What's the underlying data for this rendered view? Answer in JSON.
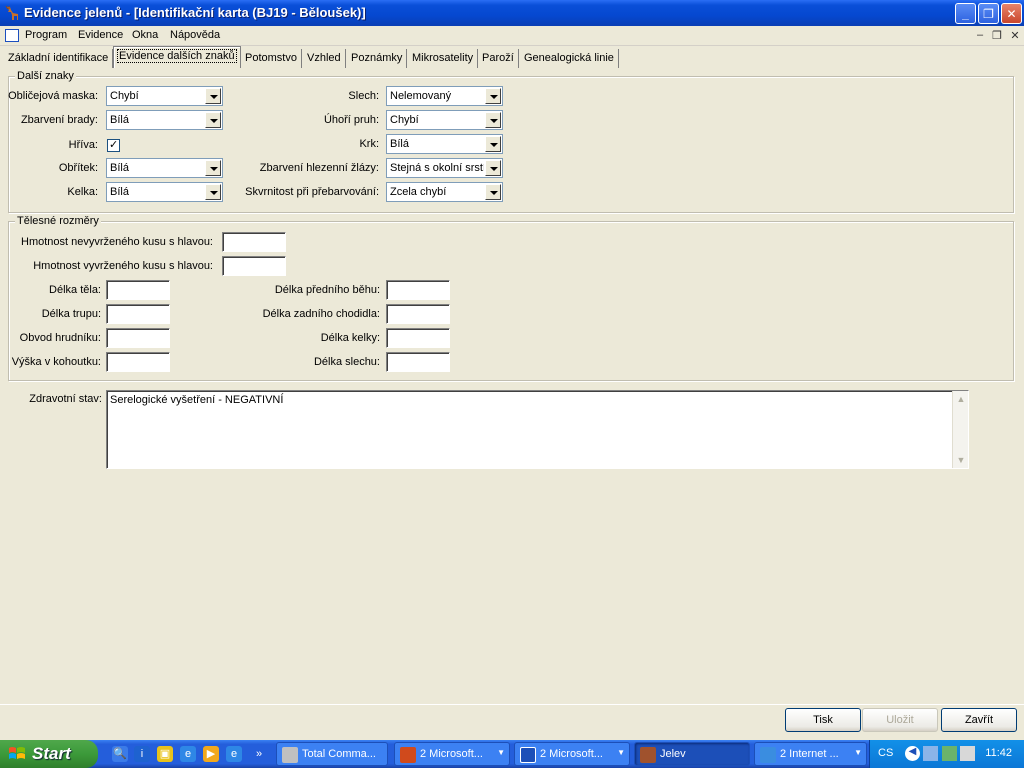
{
  "window": {
    "title": "Evidence jelenů - [Identifikační karta (BJ19 - Běloušek)]",
    "caption_buttons": {
      "minimize": "_",
      "restore": "❐",
      "close": "✕"
    }
  },
  "menu": {
    "items": [
      "Program",
      "Evidence",
      "Okna",
      "Nápověda"
    ],
    "mdi_buttons": {
      "minimize": "–",
      "restore": "❐",
      "close": "✕"
    }
  },
  "tabs": [
    "Základní identifikace",
    "Evidence dalších znaků",
    "Potomstvo",
    "Vzhled",
    "Poznámky",
    "Mikrosatelity",
    "Paroží",
    "Genealogická linie"
  ],
  "active_tab": "Evidence dalších znaků",
  "group_traits": {
    "label": "Další znaky",
    "left": [
      {
        "label": "Obličejová maska:",
        "value": "Chybí"
      },
      {
        "label": "Zbarvení brady:",
        "value": "Bílá"
      },
      {
        "label": "Hříva:",
        "checked": true
      },
      {
        "label": "Obřítek:",
        "value": "Bílá"
      },
      {
        "label": "Kelka:",
        "value": "Bílá"
      }
    ],
    "right": [
      {
        "label": "Slech:",
        "value": "Nelemovaný"
      },
      {
        "label": "Úhoří pruh:",
        "value": "Chybí"
      },
      {
        "label": "Krk:",
        "value": "Bílá"
      },
      {
        "label": "Zbarvení hlezenní žlázy:",
        "value": "Stejná s okolní srstí"
      },
      {
        "label": "Skvrnitost při přebarvování:",
        "value": "Zcela chybí"
      }
    ]
  },
  "group_body": {
    "label": "Tělesné rozměry",
    "weights": [
      {
        "label": "Hmotnost nevyvrženého kusu s hlavou:",
        "value": ""
      },
      {
        "label": "Hmotnost vyvrženého kusu s hlavou:",
        "value": ""
      }
    ],
    "left": [
      {
        "label": "Délka těla:",
        "value": ""
      },
      {
        "label": "Délka trupu:",
        "value": ""
      },
      {
        "label": "Obvod hrudníku:",
        "value": ""
      },
      {
        "label": "Výška v kohoutku:",
        "value": ""
      }
    ],
    "right": [
      {
        "label": "Délka předního běhu:",
        "value": ""
      },
      {
        "label": "Délka zadního chodidla:",
        "value": ""
      },
      {
        "label": "Délka kelky:",
        "value": ""
      },
      {
        "label": "Délka slechu:",
        "value": ""
      }
    ]
  },
  "health": {
    "label": "Zdravotní stav:",
    "value": "Serelogické vyšetření - NEGATIVNÍ"
  },
  "buttons": {
    "print": "Tisk",
    "save": "Uložit",
    "close": "Zavřít"
  },
  "taskbar": {
    "start": "Start",
    "tasks": [
      {
        "label": "Total Comma...",
        "icon_color": "#c0c0c0"
      },
      {
        "label": "2 Microsoft...",
        "icon_color": "#d04a1c"
      },
      {
        "label": "2 Microsoft...",
        "icon_color": "#1c4fb8"
      },
      {
        "label": "Jelev",
        "icon_color": "#a0522d"
      },
      {
        "label": "2 Internet ...",
        "icon_color": "#3a8de0"
      }
    ],
    "language": "CS",
    "clock": "11:42"
  }
}
